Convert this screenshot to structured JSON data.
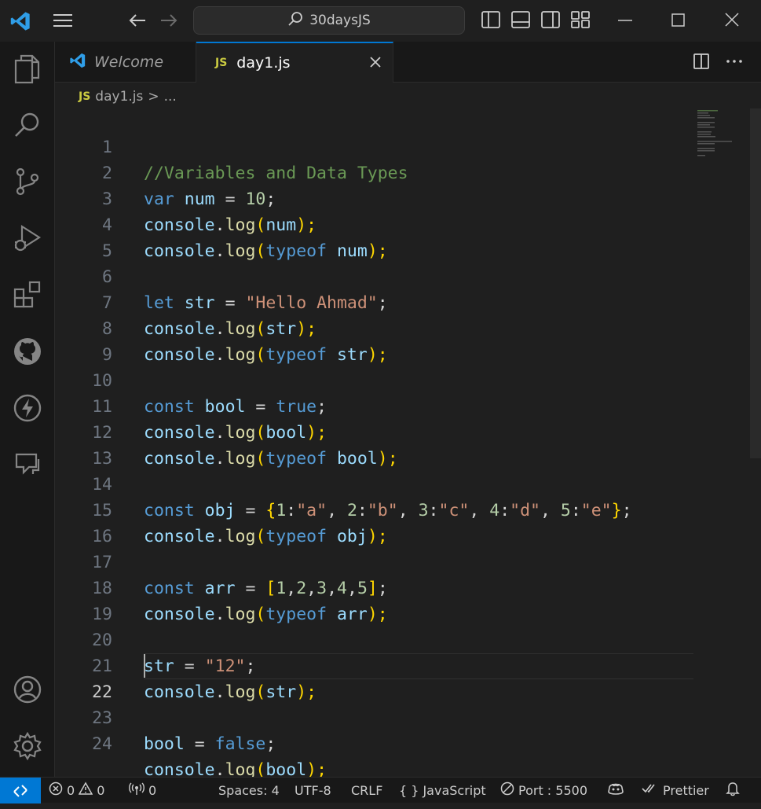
{
  "titlebar": {
    "search_text": "30daysJS"
  },
  "tabs": [
    {
      "label": "Welcome"
    },
    {
      "label": "day1.js",
      "badge": "JS"
    }
  ],
  "breadcrumb": {
    "badge": "JS",
    "file": "day1.js",
    "separator": ">",
    "rest": "..."
  },
  "editor": {
    "current_line": 22,
    "lines": [
      {
        "n": "1"
      },
      {
        "n": "2"
      },
      {
        "n": "3"
      },
      {
        "n": "4"
      },
      {
        "n": "5"
      },
      {
        "n": "6"
      },
      {
        "n": "7"
      },
      {
        "n": "8"
      },
      {
        "n": "9"
      },
      {
        "n": "10"
      },
      {
        "n": "11"
      },
      {
        "n": "12"
      },
      {
        "n": "13"
      },
      {
        "n": "14"
      },
      {
        "n": "15"
      },
      {
        "n": "16"
      },
      {
        "n": "17"
      },
      {
        "n": "18"
      },
      {
        "n": "19"
      },
      {
        "n": "20"
      },
      {
        "n": "21"
      },
      {
        "n": "22"
      },
      {
        "n": "23"
      },
      {
        "n": "24"
      }
    ],
    "code": {
      "l1": "//Variables and Data Types",
      "l2": [
        "var",
        " num",
        " = ",
        "10",
        ";"
      ],
      "l3": [
        "console",
        ".",
        "log",
        "(",
        "num",
        ");"
      ],
      "l4": [
        "console",
        ".",
        "log",
        "(",
        "typeof",
        " num",
        ");"
      ],
      "l6": [
        "let",
        " str",
        " = ",
        "\"Hello Ahmad\"",
        ";"
      ],
      "l7": [
        "console",
        ".",
        "log",
        "(",
        "str",
        ");"
      ],
      "l8": [
        "console",
        ".",
        "log",
        "(",
        "typeof",
        " str",
        ");"
      ],
      "l10": [
        "const",
        " bool",
        " = ",
        "true",
        ";"
      ],
      "l11": [
        "console",
        ".",
        "log",
        "(",
        "bool",
        ");"
      ],
      "l12": [
        "console",
        ".",
        "log",
        "(",
        "typeof",
        " bool",
        ");"
      ],
      "l14": [
        "const",
        " obj",
        " = ",
        "{",
        "1",
        ":",
        "\"a\"",
        ", ",
        "2",
        ":",
        "\"b\"",
        ", ",
        "3",
        ":",
        "\"c\"",
        ", ",
        "4",
        ":",
        "\"d\"",
        ", ",
        "5",
        ":",
        "\"e\"",
        "}",
        ";"
      ],
      "l15": [
        "console",
        ".",
        "log",
        "(",
        "typeof",
        " obj",
        ");"
      ],
      "l17": [
        "const",
        " arr",
        " = ",
        "[",
        "1",
        ",",
        "2",
        ",",
        "3",
        ",",
        "4",
        ",",
        "5",
        "]",
        ";"
      ],
      "l18": [
        "console",
        ".",
        "log",
        "(",
        "typeof",
        " arr",
        ");"
      ],
      "l20": [
        "str",
        " = ",
        "\"12\"",
        ";"
      ],
      "l21": [
        "console",
        ".",
        "log",
        "(",
        "str",
        ");"
      ],
      "l23": [
        "bool",
        " = ",
        "false",
        ";"
      ],
      "l24": [
        "console",
        ".",
        "log",
        "(",
        "bool",
        ");"
      ]
    }
  },
  "statusbar": {
    "errors": "0",
    "warnings": "0",
    "ports": "0",
    "spaces": "Spaces: 4",
    "encoding": "UTF-8",
    "eol": "CRLF",
    "language_braces": "{ }",
    "language": "JavaScript",
    "port": "Port : 5500",
    "prettier": "Prettier"
  },
  "colors": {
    "accent": "#0078d4",
    "editor_bg": "#1f1f1f",
    "keyword": "#569cd6",
    "string": "#ce9178",
    "number": "#b5cea8",
    "comment": "#6a9955",
    "function": "#dcdcaa",
    "bracket": "#ffd700"
  }
}
